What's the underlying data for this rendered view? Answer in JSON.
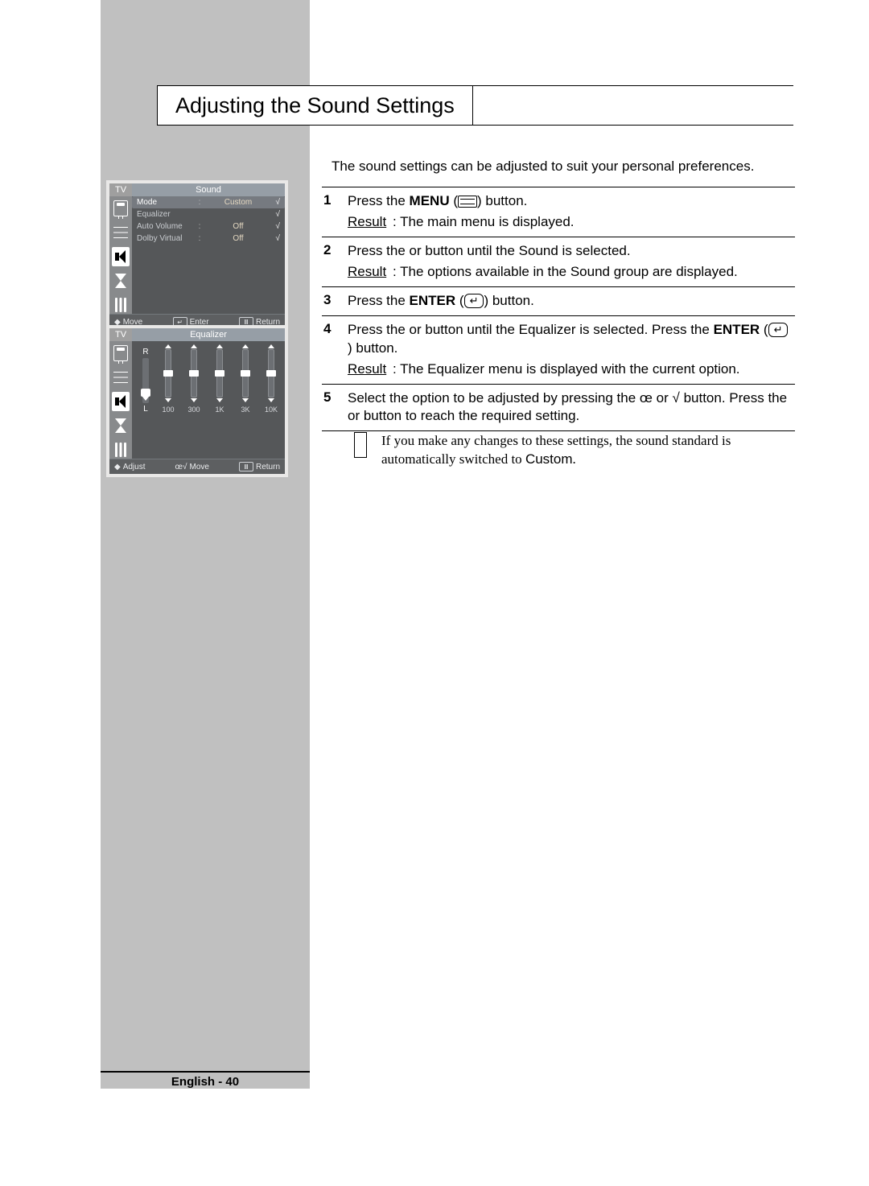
{
  "title": "Adjusting the Sound Settings",
  "intro": "The sound settings can be adjusted to suit your personal preferences.",
  "osd1": {
    "tv_label": "TV",
    "header": "Sound",
    "rows": [
      {
        "label": "Mode",
        "colon": ":",
        "value": "Custom",
        "chev": "√",
        "selected": true
      },
      {
        "label": "Equalizer",
        "colon": "",
        "value": "",
        "chev": "√",
        "selected": false
      },
      {
        "label": "Auto Volume",
        "colon": ":",
        "value": "Off",
        "chev": "√",
        "selected": false
      },
      {
        "label": "Dolby Virtual",
        "colon": ":",
        "value": "Off",
        "chev": "√",
        "selected": false
      }
    ],
    "footer": {
      "left_sym": "",
      "left": "Move",
      "mid": "Enter",
      "right": "Return"
    }
  },
  "osd2": {
    "tv_label": "TV",
    "header": "Equalizer",
    "balance": {
      "top": "R",
      "bottom": "L"
    },
    "bands": [
      "100",
      "300",
      "1K",
      "3K",
      "10K"
    ],
    "footer": {
      "left_sym": "",
      "left": "Adjust",
      "mid": "Move",
      "right": "Return"
    }
  },
  "steps": [
    {
      "num": "1",
      "parts": [
        {
          "t": "Press the "
        },
        {
          "b": "MENU"
        },
        {
          "t": " ("
        },
        {
          "menu_glyph": true
        },
        {
          "t": ")  button."
        }
      ],
      "result": "The main menu is displayed."
    },
    {
      "num": "2",
      "parts": [
        {
          "t": "Press the  "
        },
        {
          "t": " or  "
        },
        {
          "t": " button until the "
        },
        {
          "i": "Sound"
        },
        {
          "t": " is selected."
        }
      ],
      "result": "The options available in the Sound group are displayed."
    },
    {
      "num": "3",
      "parts": [
        {
          "t": "Press the "
        },
        {
          "b": "ENTER"
        },
        {
          "t": " ("
        },
        {
          "enter_glyph": "↵"
        },
        {
          "t": ") button."
        }
      ]
    },
    {
      "num": "4",
      "parts": [
        {
          "t": "Press the  "
        },
        {
          "t": " or  "
        },
        {
          "t": " button until the "
        },
        {
          "i": "Equalizer"
        },
        {
          "t": "  is selected. Press the "
        },
        {
          "b": "ENTER"
        },
        {
          "t": " ("
        },
        {
          "enter_glyph": "↵"
        },
        {
          "t": ") button."
        }
      ],
      "result": "The Equalizer  menu is displayed with the current option."
    },
    {
      "num": "5",
      "parts": [
        {
          "t": "Select the option to be adjusted by pressing the œ or √ button. Press the  "
        },
        {
          "t": " or  "
        },
        {
          "t": " button to reach the required setting."
        }
      ]
    }
  ],
  "labels": {
    "result": "Result",
    "colon": ":"
  },
  "note": "If you make any changes to these settings, the sound standard is automatically switched to Custom.",
  "note_custom_word": "Custom",
  "footer": "English - 40"
}
